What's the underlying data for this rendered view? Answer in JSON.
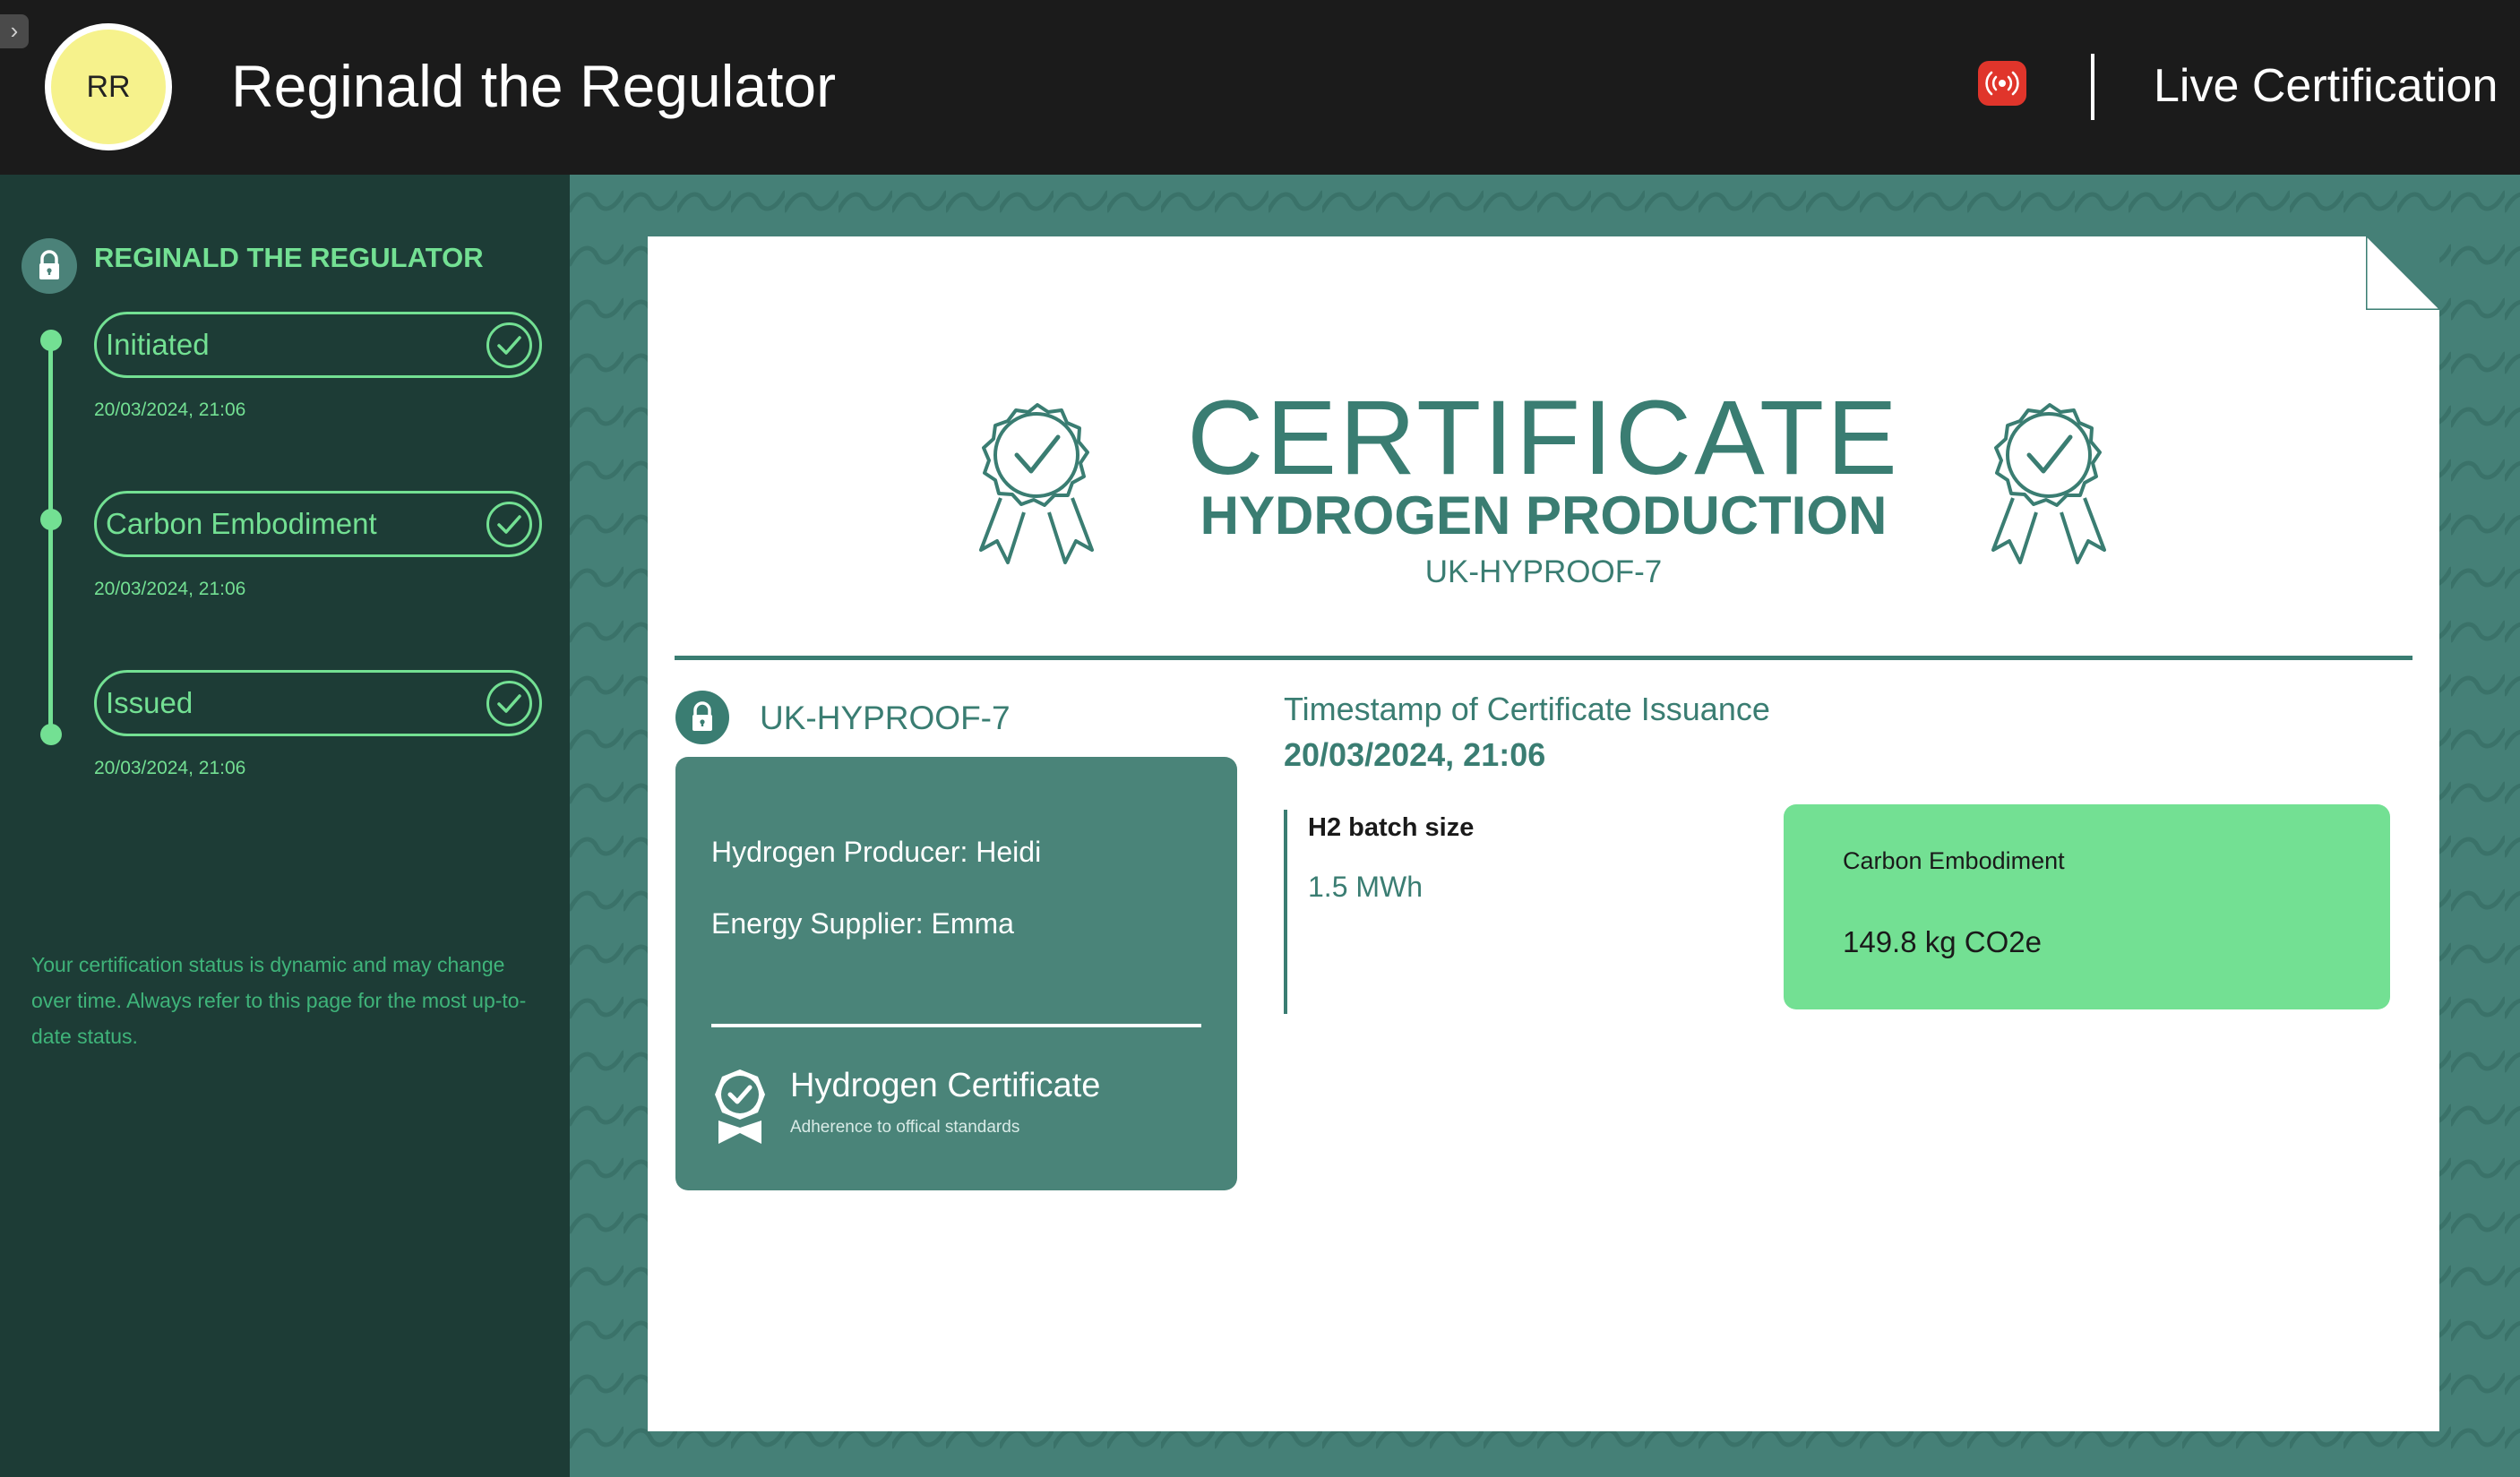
{
  "header": {
    "avatar_initials": "RR",
    "title": "Reginald the Regulator",
    "live_label": "Live Certification"
  },
  "sidebar": {
    "heading": "REGINALD THE REGULATOR",
    "steps": [
      {
        "label": "Initiated",
        "timestamp": "20/03/2024, 21:06"
      },
      {
        "label": "Carbon Embodiment",
        "timestamp": "20/03/2024, 21:06"
      },
      {
        "label": "Issued",
        "timestamp": "20/03/2024, 21:06"
      }
    ],
    "note": "Your certification status is dynamic and may change over time. Always refer to this page for the most up-to-date status."
  },
  "certificate": {
    "title": "CERTIFICATE",
    "subtitle": "HYDROGEN PRODUCTION",
    "code": "UK-HYPROOF-7",
    "id_code": "UK-HYPROOF-7",
    "producer": "Hydrogen Producer: Heidi",
    "supplier": "Energy Supplier: Emma",
    "badge_title": "Hydrogen Certificate",
    "badge_subtitle": "Adherence to offical standards",
    "timestamp_label": "Timestamp of Certificate Issuance",
    "timestamp_value": "20/03/2024, 21:06",
    "batch_label": "H2 batch size",
    "batch_value": "1.5 MWh",
    "carbon_label": "Carbon Embodiment",
    "carbon_value": "149.8 kg CO2e"
  },
  "colors": {
    "accent_green": "#73e093",
    "teal": "#3a7d72",
    "sidebar_bg": "#1d3c36",
    "live_red": "#e0352b",
    "avatar_yellow": "#f6f28c"
  },
  "icons": {
    "expand": "chevron-right-icon",
    "live": "broadcast-icon",
    "lock": "lock-icon",
    "check": "check-circle-icon",
    "rosette": "award-rosette-icon",
    "badge": "certificate-badge-icon"
  }
}
